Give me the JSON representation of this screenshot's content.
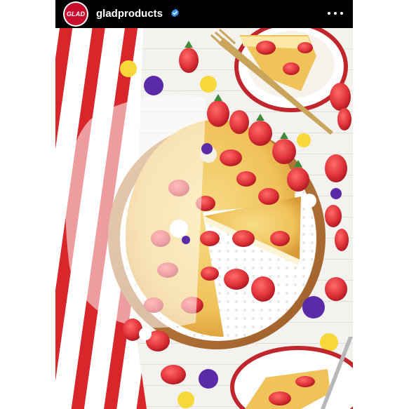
{
  "post": {
    "avatar_logo_text": "GLAD",
    "username": "gladproducts",
    "verified_icon": "verified-badge-icon",
    "more_icon": "more-options-icon",
    "colors": {
      "header_bg": "#000000",
      "verified": "#3897f0",
      "brand_red": "#c8102e"
    }
  }
}
